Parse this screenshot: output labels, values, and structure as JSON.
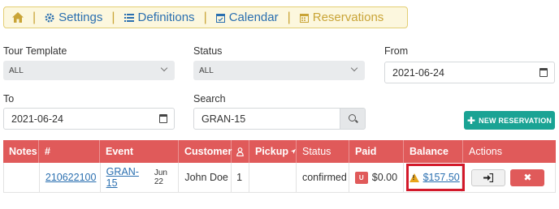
{
  "nav": {
    "items": [
      {
        "label": "",
        "icon": "home-icon"
      },
      {
        "label": "Settings",
        "icon": "gear-icon"
      },
      {
        "label": "Definitions",
        "icon": "list-icon"
      },
      {
        "label": "Calendar",
        "icon": "calendar-icon"
      },
      {
        "label": "Reservations",
        "icon": "calendar-grid-icon"
      }
    ],
    "separator": "|",
    "colors": {
      "link": "#2a6fb0",
      "active": "#c9a437",
      "background": "#fcf7de"
    }
  },
  "filters": {
    "tour_template": {
      "label": "Tour Template",
      "value": "ALL"
    },
    "status": {
      "label": "Status",
      "value": "ALL"
    },
    "from": {
      "label": "From",
      "value": "2021-06-24"
    },
    "to": {
      "label": "To",
      "value": "2021-06-24"
    },
    "search": {
      "label": "Search",
      "value": "GRAN-15"
    }
  },
  "new_reservation_button": {
    "label": "NEW RESERVATION",
    "icon": "plus-icon",
    "color": "#1aa394"
  },
  "table": {
    "header_color": "#e05a5a",
    "headers": [
      "Notes",
      "#",
      "Event",
      "Customer",
      "",
      "Pickup",
      "Status",
      "Paid",
      "Balance",
      "Actions"
    ],
    "header_icons": {
      "pax": "person-icon",
      "pickup": "location-arrow-icon"
    },
    "rows": [
      {
        "notes": "",
        "number": "210622100",
        "event": "GRAN-15",
        "event_date": "Jun 22",
        "customer": "John Doe",
        "pax": "1",
        "pickup": "",
        "status": "confirmed",
        "paid_badge": "U",
        "paid": "$0.00",
        "balance": "$157.50",
        "balance_icon": "warning-icon",
        "actions": [
          "login-icon",
          "delete-icon"
        ]
      }
    ]
  },
  "highlight_color": "#d3192a"
}
